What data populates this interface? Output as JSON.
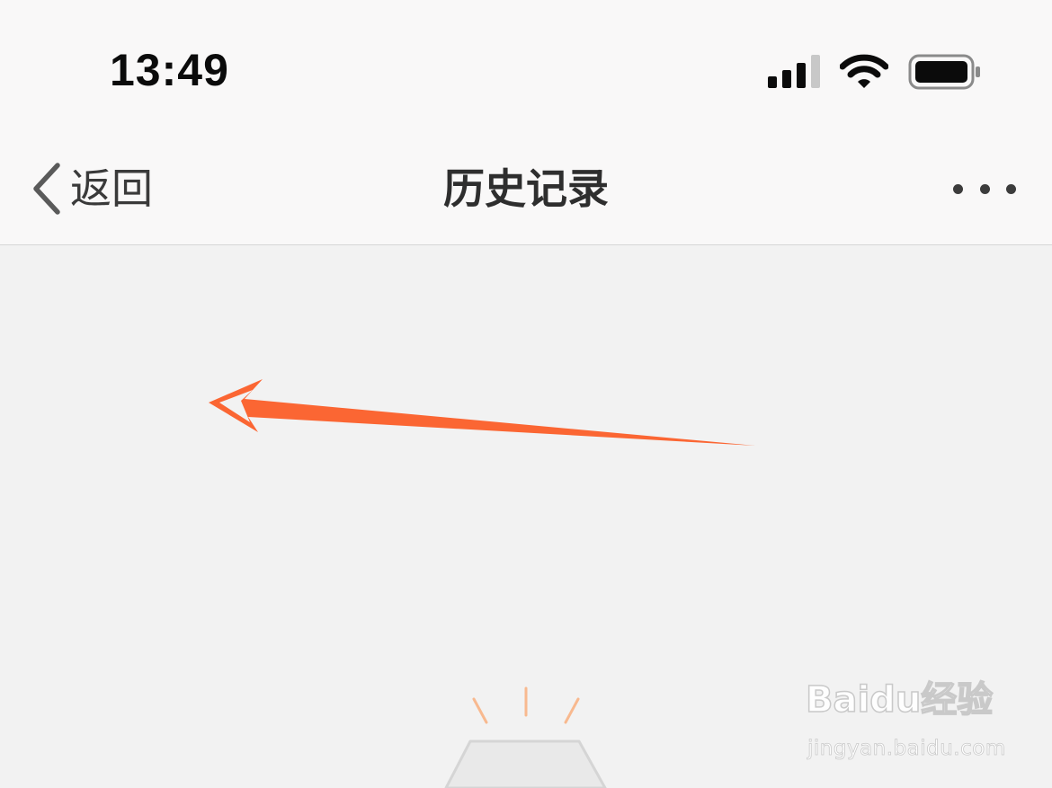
{
  "status_bar": {
    "time": "13:49",
    "signal_bars": 4,
    "signal_bars_active": 3,
    "icons": [
      "signal-icon",
      "wifi-icon",
      "battery-icon"
    ]
  },
  "nav_bar": {
    "back_label": "返回",
    "title": "历史记录",
    "more_icon": "more-dots-icon"
  },
  "annotation": {
    "icon": "red-arrow-icon",
    "color": "#fb6633"
  },
  "empty_state": {
    "icon": "empty-box-icon",
    "accent_color": "#f8b98f"
  },
  "watermark": {
    "brand": "Baidu经验",
    "url": "jingyan.baidu.com"
  },
  "colors": {
    "background": "#f2f2f2",
    "bar_background": "#f9f8f8",
    "text_primary": "#2e2e2e",
    "arrow": "#fb6633"
  }
}
